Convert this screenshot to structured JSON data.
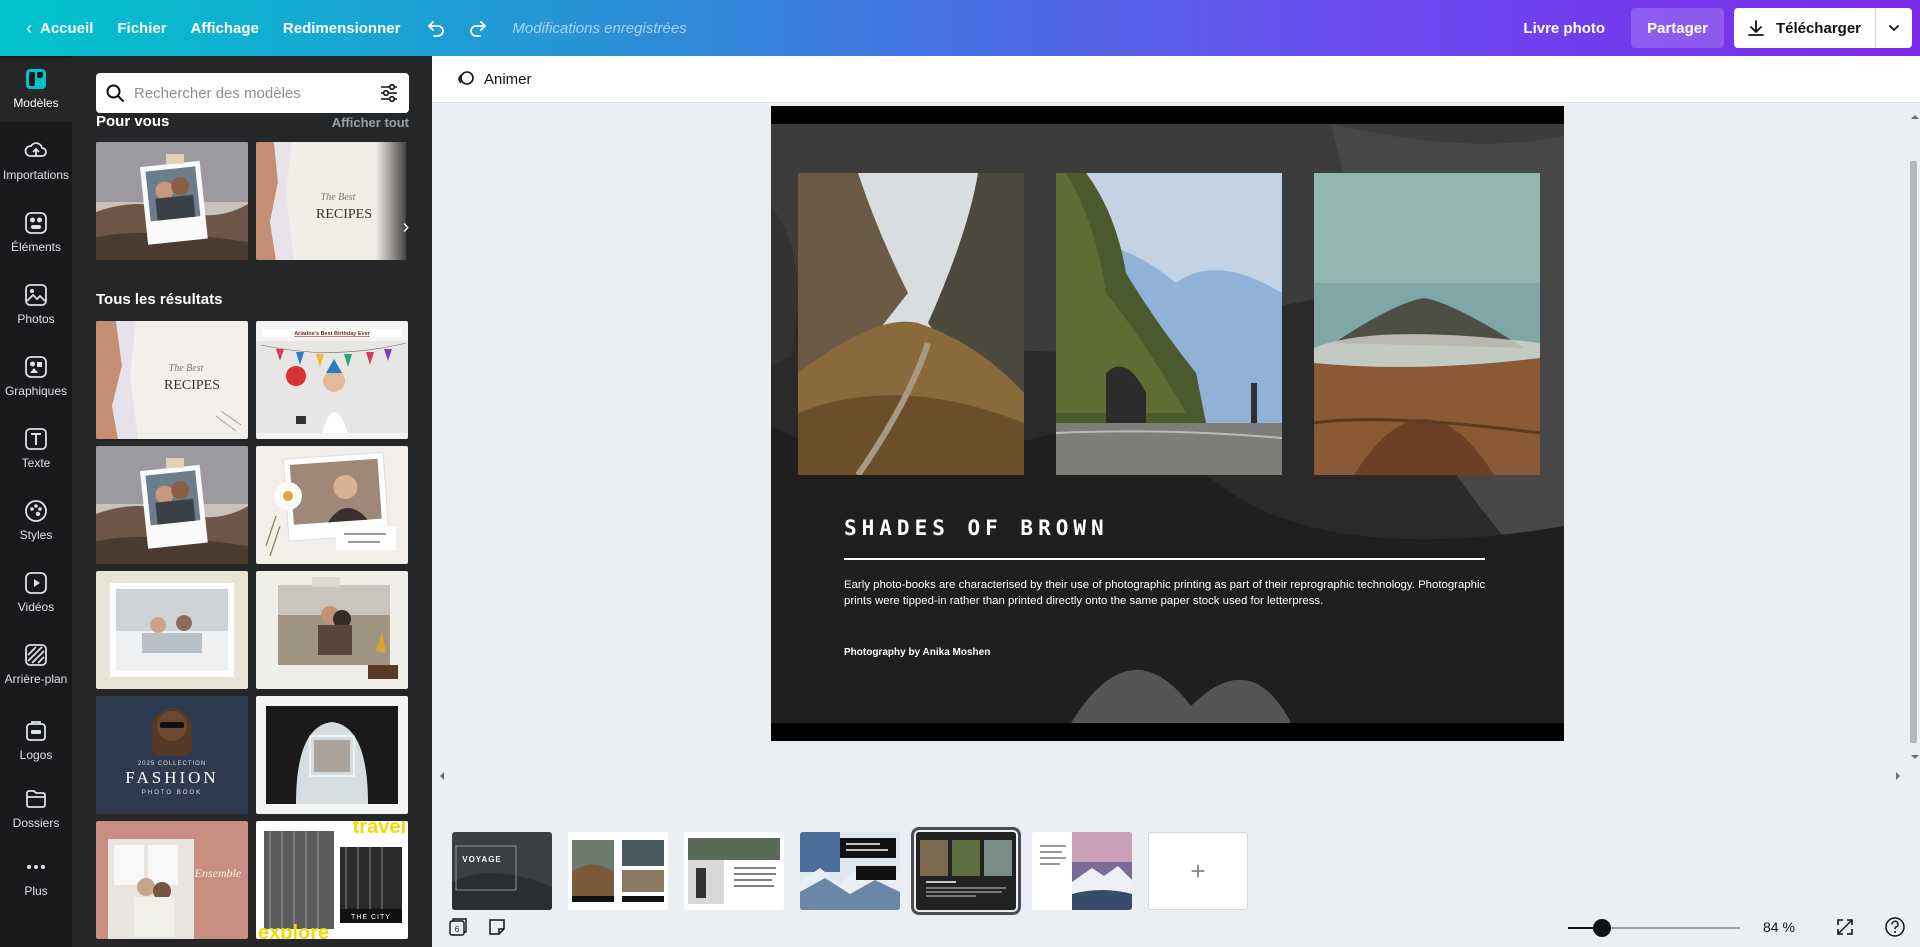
{
  "topbar": {
    "home_label": "Accueil",
    "file_label": "Fichier",
    "view_label": "Affichage",
    "resize_label": "Redimensionner",
    "status": "Modifications enregistrées",
    "doc_title": "Livre photo",
    "share_label": "Partager",
    "download_label": "Télécharger"
  },
  "rail": {
    "items": [
      {
        "label": "Modèles",
        "icon": "templates-icon"
      },
      {
        "label": "Importations",
        "icon": "upload-icon"
      },
      {
        "label": "Éléments",
        "icon": "elements-icon"
      },
      {
        "label": "Photos",
        "icon": "photos-icon"
      },
      {
        "label": "Graphiques",
        "icon": "graphics-icon"
      },
      {
        "label": "Texte",
        "icon": "text-icon"
      },
      {
        "label": "Styles",
        "icon": "styles-icon"
      },
      {
        "label": "Vidéos",
        "icon": "videos-icon"
      },
      {
        "label": "Arrière-plan",
        "icon": "background-icon"
      },
      {
        "label": "Logos",
        "icon": "logos-icon"
      },
      {
        "label": "Dossiers",
        "icon": "folders-icon"
      },
      {
        "label": "Plus",
        "icon": "more-icon"
      }
    ]
  },
  "panel": {
    "search_placeholder": "Rechercher des modèles",
    "for_you_title": "Pour vous",
    "see_all": "Afficher tout",
    "all_results_title": "Tous les résultats",
    "thumb_texts": {
      "recipes": "RECIPES",
      "birthday": "Ariadne's Best Birthday Ever",
      "fashion": "FASHION",
      "fashion_sub": "PHOTO BOOK",
      "fashion_year": "2025 COLLECTION",
      "city": "THE CITY",
      "travel": "travel",
      "explore": "explore"
    }
  },
  "editor": {
    "animate_label": "Animer",
    "page": {
      "title": "SHADES OF BROWN",
      "body": "Early photo-books are characterised by their use of photographic printing as part of their reprographic technology. Photographic prints were tipped-in rather than printed directly onto the same paper stock used for letterpress.",
      "credit": "Photography by Anika Moshen"
    },
    "pages_strip": {
      "voyage_label": "VOYAGE",
      "page_count": "6",
      "add_label": "+"
    },
    "zoom": {
      "value": 0.2,
      "label": "84 %"
    }
  },
  "colors": {
    "accent_gradient_start": "#00c4cc",
    "accent_gradient_end": "#7d2ae8",
    "rail_bg": "#18191b",
    "panel_bg": "#252627",
    "canvas_bg": "#ebeef2"
  }
}
